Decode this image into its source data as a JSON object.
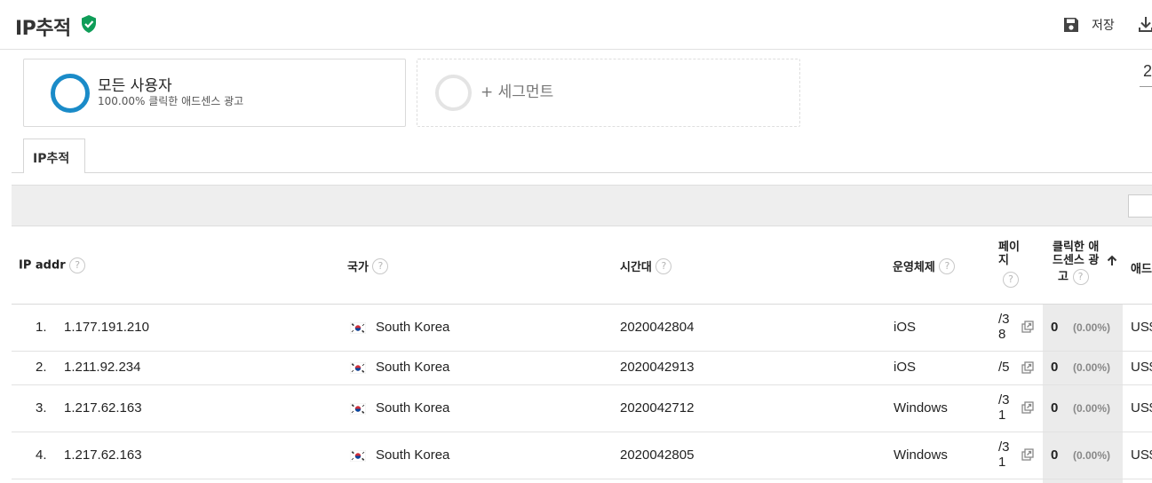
{
  "header": {
    "title": "IP추적",
    "save_label": "저장"
  },
  "segments": {
    "all": {
      "title": "모든 사용자",
      "subtitle": "100.00% 클릭한 애드센스 광고"
    },
    "add": {
      "label": "+ 세그먼트"
    },
    "date_fragment": "2"
  },
  "tab": {
    "label": "IP추적"
  },
  "table": {
    "columns": {
      "ip": "IP addr",
      "country": "국가",
      "timezone": "시간대",
      "os": "운영체제",
      "page_line1": "페이",
      "page_line2": "지",
      "clicks_line1": "클릭한 애",
      "clicks_line2": "드센스 광",
      "clicks_line3": "고",
      "next_col": "애드"
    },
    "help_glyph": "?",
    "rows": [
      {
        "index": "1.",
        "ip": "1.177.191.210",
        "country": "South Korea",
        "timezone": "2020042804",
        "os": "iOS",
        "page_line1": "/3",
        "page_line2": "8",
        "clicks": "0",
        "clicks_pct": "(0.00%)",
        "next": "US$"
      },
      {
        "index": "2.",
        "ip": "1.211.92.234",
        "country": "South Korea",
        "timezone": "2020042913",
        "os": "iOS",
        "page_line1": "/5",
        "page_line2": "",
        "clicks": "0",
        "clicks_pct": "(0.00%)",
        "next": "US$"
      },
      {
        "index": "3.",
        "ip": "1.217.62.163",
        "country": "South Korea",
        "timezone": "2020042712",
        "os": "Windows",
        "page_line1": "/3",
        "page_line2": "1",
        "clicks": "0",
        "clicks_pct": "(0.00%)",
        "next": "US$"
      },
      {
        "index": "4.",
        "ip": "1.217.62.163",
        "country": "South Korea",
        "timezone": "2020042805",
        "os": "Windows",
        "page_line1": "/3",
        "page_line2": "1",
        "clicks": "0",
        "clicks_pct": "(0.00%)",
        "next": "US$"
      }
    ]
  },
  "colors": {
    "accent_blue": "#1a8bc8",
    "verified_green": "#0f9d58",
    "sorted_column_bg": "#ebebeb"
  }
}
